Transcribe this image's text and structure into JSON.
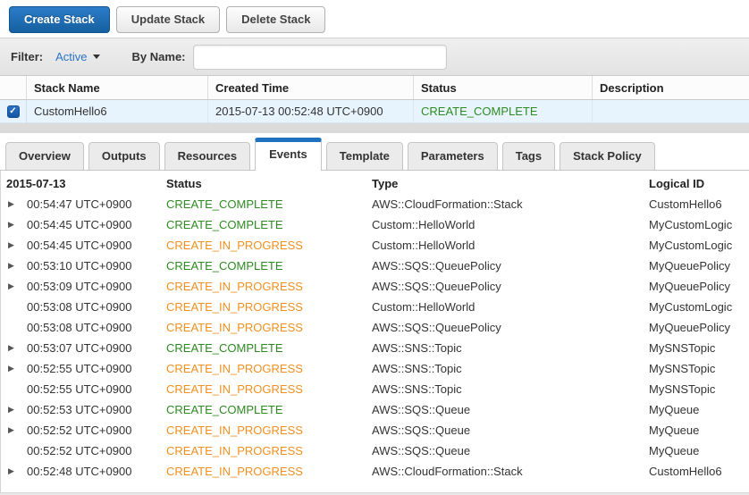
{
  "colors": {
    "primary_button_blue": "#15609f",
    "link_blue": "#2b73c8",
    "tab_active_blue": "#1e72bf",
    "status_complete_green": "#2e8b22",
    "status_in_progress_orange": "#ef901f",
    "selected_row_blue": "#e8f4fd"
  },
  "toolbar": {
    "create_label": "Create Stack",
    "update_label": "Update Stack",
    "delete_label": "Delete Stack"
  },
  "filter": {
    "filter_label": "Filter:",
    "filter_value": "Active",
    "by_name_label": "By Name:",
    "by_name_value": ""
  },
  "stacks": {
    "columns": [
      "Stack Name",
      "Created Time",
      "Status",
      "Description"
    ],
    "rows": [
      {
        "checked": true,
        "stack_name": "CustomHello6",
        "created_time": "2015-07-13 00:52:48 UTC+0900",
        "status": "CREATE_COMPLETE",
        "description": ""
      }
    ]
  },
  "tabs": {
    "items": [
      "Overview",
      "Outputs",
      "Resources",
      "Events",
      "Template",
      "Parameters",
      "Tags",
      "Stack Policy"
    ],
    "active": "Events"
  },
  "events": {
    "date_header": "2015-07-13",
    "columns": [
      "Status",
      "Type",
      "Logical ID"
    ],
    "expand_icon": "▶",
    "rows": [
      {
        "expandable": true,
        "time": "00:54:47 UTC+0900",
        "status": "CREATE_COMPLETE",
        "type": "AWS::CloudFormation::Stack",
        "logical_id": "CustomHello6"
      },
      {
        "expandable": true,
        "time": "00:54:45 UTC+0900",
        "status": "CREATE_COMPLETE",
        "type": "Custom::HelloWorld",
        "logical_id": "MyCustomLogic"
      },
      {
        "expandable": true,
        "time": "00:54:45 UTC+0900",
        "status": "CREATE_IN_PROGRESS",
        "type": "Custom::HelloWorld",
        "logical_id": "MyCustomLogic"
      },
      {
        "expandable": true,
        "time": "00:53:10 UTC+0900",
        "status": "CREATE_COMPLETE",
        "type": "AWS::SQS::QueuePolicy",
        "logical_id": "MyQueuePolicy"
      },
      {
        "expandable": true,
        "time": "00:53:09 UTC+0900",
        "status": "CREATE_IN_PROGRESS",
        "type": "AWS::SQS::QueuePolicy",
        "logical_id": "MyQueuePolicy"
      },
      {
        "expandable": false,
        "time": "00:53:08 UTC+0900",
        "status": "CREATE_IN_PROGRESS",
        "type": "Custom::HelloWorld",
        "logical_id": "MyCustomLogic"
      },
      {
        "expandable": false,
        "time": "00:53:08 UTC+0900",
        "status": "CREATE_IN_PROGRESS",
        "type": "AWS::SQS::QueuePolicy",
        "logical_id": "MyQueuePolicy"
      },
      {
        "expandable": true,
        "time": "00:53:07 UTC+0900",
        "status": "CREATE_COMPLETE",
        "type": "AWS::SNS::Topic",
        "logical_id": "MySNSTopic"
      },
      {
        "expandable": true,
        "time": "00:52:55 UTC+0900",
        "status": "CREATE_IN_PROGRESS",
        "type": "AWS::SNS::Topic",
        "logical_id": "MySNSTopic"
      },
      {
        "expandable": false,
        "time": "00:52:55 UTC+0900",
        "status": "CREATE_IN_PROGRESS",
        "type": "AWS::SNS::Topic",
        "logical_id": "MySNSTopic"
      },
      {
        "expandable": true,
        "time": "00:52:53 UTC+0900",
        "status": "CREATE_COMPLETE",
        "type": "AWS::SQS::Queue",
        "logical_id": "MyQueue"
      },
      {
        "expandable": true,
        "time": "00:52:52 UTC+0900",
        "status": "CREATE_IN_PROGRESS",
        "type": "AWS::SQS::Queue",
        "logical_id": "MyQueue"
      },
      {
        "expandable": false,
        "time": "00:52:52 UTC+0900",
        "status": "CREATE_IN_PROGRESS",
        "type": "AWS::SQS::Queue",
        "logical_id": "MyQueue"
      },
      {
        "expandable": true,
        "time": "00:52:48 UTC+0900",
        "status": "CREATE_IN_PROGRESS",
        "type": "AWS::CloudFormation::Stack",
        "logical_id": "CustomHello6"
      }
    ]
  }
}
